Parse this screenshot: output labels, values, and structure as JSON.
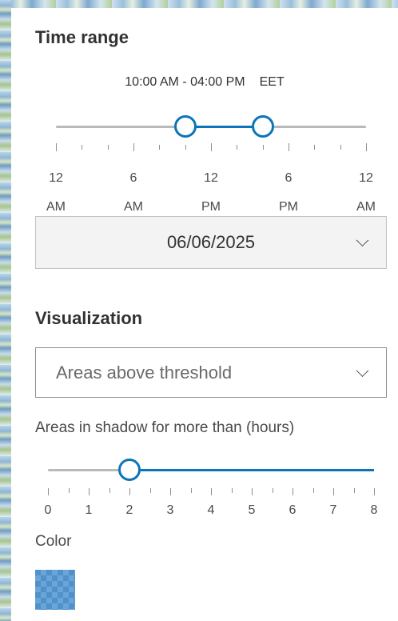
{
  "time_range": {
    "heading": "Time range",
    "range_text": "10:00 AM - 04:00 PM",
    "timezone": "EET",
    "start_fraction": 0.4167,
    "end_fraction": 0.6667,
    "tick_labels": [
      {
        "top": "12",
        "bottom": "AM"
      },
      {
        "top": "6",
        "bottom": "AM"
      },
      {
        "top": "12",
        "bottom": "PM"
      },
      {
        "top": "6",
        "bottom": "PM"
      },
      {
        "top": "12",
        "bottom": "AM"
      }
    ],
    "date": "06/06/2025"
  },
  "visualization": {
    "heading": "Visualization",
    "selected": "Areas above threshold",
    "threshold_label": "Areas in shadow for more than (hours)",
    "threshold_value": 2,
    "threshold_min": 0,
    "threshold_max": 8,
    "scale_labels": [
      "0",
      "1",
      "2",
      "3",
      "4",
      "5",
      "6",
      "7",
      "8"
    ],
    "color_label": "Color",
    "color": "#3c86c5"
  },
  "colors": {
    "accent": "#0b75b9",
    "track": "#b9b9b9"
  }
}
